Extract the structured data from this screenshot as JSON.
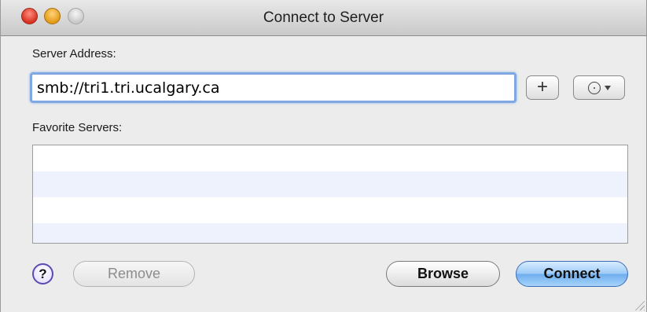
{
  "window": {
    "title": "Connect to Server"
  },
  "address": {
    "label": "Server Address:",
    "value": "smb://tri1.tri.ucalgary.ca"
  },
  "add_button": {
    "label": "+"
  },
  "recent_button": {
    "icon": "clock-icon"
  },
  "favorites": {
    "label": "Favorite Servers:",
    "rows": [
      "",
      "",
      "",
      ""
    ]
  },
  "help_button": {
    "label": "?"
  },
  "buttons": {
    "remove": "Remove",
    "browse": "Browse",
    "connect": "Connect"
  },
  "colors": {
    "accent": "#6eadee",
    "focus_ring": "#7fa8e3",
    "row_alt": "#edf2fd"
  }
}
